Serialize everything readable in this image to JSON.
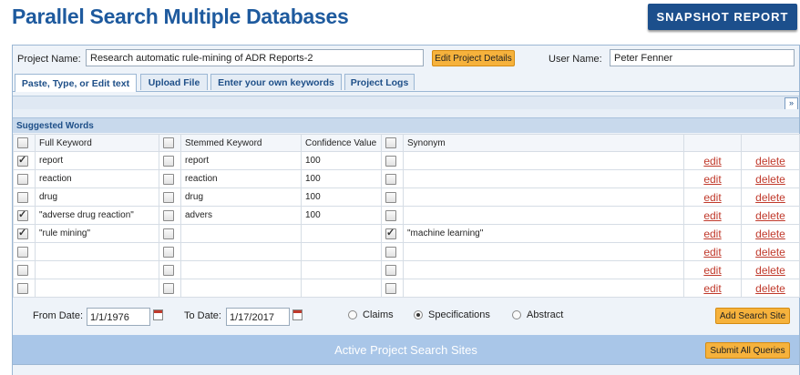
{
  "header": {
    "title": "Parallel Search Multiple Databases",
    "snapshot_label": "SNAPSHOT REPORT"
  },
  "project": {
    "name_label": "Project Name:",
    "name_value": "Research automatic rule-mining of ADR Reports-2",
    "edit_label": "Edit Project Details",
    "user_label": "User Name:",
    "user_value": "Peter Fenner"
  },
  "tabs": [
    {
      "label": "Paste, Type, or Edit text",
      "active": true
    },
    {
      "label": "Upload File",
      "active": false
    },
    {
      "label": "Enter your own keywords",
      "active": false
    },
    {
      "label": "Project Logs",
      "active": false
    }
  ],
  "suggested": {
    "heading": "Suggested Words",
    "columns": {
      "full": "Full Keyword",
      "stemmed": "Stemmed Keyword",
      "confidence": "Confidence Value",
      "synonym": "Synonym"
    },
    "edit_label": "edit",
    "delete_label": "delete",
    "rows": [
      {
        "full_checked": true,
        "full": "report",
        "stem_checked": false,
        "stemmed": "report",
        "confidence": "100",
        "syn_checked": false,
        "synonym": ""
      },
      {
        "full_checked": false,
        "full": "reaction",
        "stem_checked": false,
        "stemmed": "reaction",
        "confidence": "100",
        "syn_checked": false,
        "synonym": ""
      },
      {
        "full_checked": false,
        "full": "drug",
        "stem_checked": false,
        "stemmed": "drug",
        "confidence": "100",
        "syn_checked": false,
        "synonym": ""
      },
      {
        "full_checked": true,
        "full": "\"adverse drug reaction\"",
        "stem_checked": false,
        "stemmed": "advers",
        "confidence": "100",
        "syn_checked": false,
        "synonym": ""
      },
      {
        "full_checked": true,
        "full": "\"rule mining\"",
        "stem_checked": false,
        "stemmed": "",
        "confidence": "",
        "syn_checked": true,
        "synonym": "\"machine learning\""
      },
      {
        "full_checked": false,
        "full": "",
        "stem_checked": false,
        "stemmed": "",
        "confidence": "",
        "syn_checked": false,
        "synonym": ""
      },
      {
        "full_checked": false,
        "full": "",
        "stem_checked": false,
        "stemmed": "",
        "confidence": "",
        "syn_checked": false,
        "synonym": ""
      },
      {
        "full_checked": false,
        "full": "",
        "stem_checked": false,
        "stemmed": "",
        "confidence": "",
        "syn_checked": false,
        "synonym": ""
      }
    ]
  },
  "dates": {
    "from_label": "From Date:",
    "from_value": "1/1/1976",
    "to_label": "To Date:",
    "to_value": "1/17/2017"
  },
  "scope": {
    "options": [
      {
        "label": "Claims",
        "selected": false
      },
      {
        "label": "Specifications",
        "selected": true
      },
      {
        "label": "Abstract",
        "selected": false
      }
    ]
  },
  "actions": {
    "add_site": "Add Search Site",
    "active_sites": "Active Project Search Sites",
    "submit_all": "Submit All Queries"
  },
  "colors": {
    "accent_blue": "#1e5a9e",
    "button_orange": "#f6b23c",
    "link_red": "#c0392b"
  }
}
